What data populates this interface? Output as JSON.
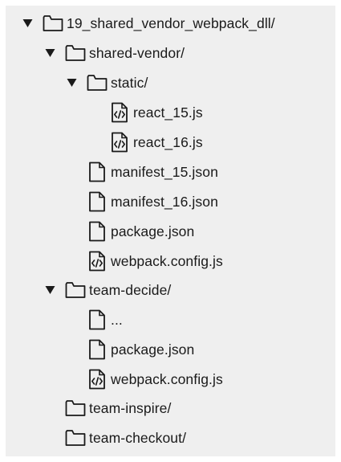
{
  "tree": {
    "root": {
      "label": "19_shared_vendor_webpack_dll/",
      "icon": "folder-icon",
      "expanded": true
    },
    "shared_vendor": {
      "label": "shared-vendor/",
      "icon": "folder-icon",
      "expanded": true
    },
    "static": {
      "label": "static/",
      "icon": "folder-icon",
      "expanded": true
    },
    "react_15": {
      "label": "react_15.js",
      "icon": "code-file-icon"
    },
    "react_16": {
      "label": "react_16.js",
      "icon": "code-file-icon"
    },
    "manifest_15": {
      "label": "manifest_15.json",
      "icon": "file-icon"
    },
    "manifest_16": {
      "label": "manifest_16.json",
      "icon": "file-icon"
    },
    "sv_package": {
      "label": "package.json",
      "icon": "file-icon"
    },
    "sv_webpack": {
      "label": "webpack.config.js",
      "icon": "code-file-icon"
    },
    "team_decide": {
      "label": "team-decide/",
      "icon": "folder-icon",
      "expanded": true
    },
    "td_ellipsis": {
      "label": "...",
      "icon": "file-icon"
    },
    "td_package": {
      "label": "package.json",
      "icon": "file-icon"
    },
    "td_webpack": {
      "label": "webpack.config.js",
      "icon": "code-file-icon"
    },
    "team_inspire": {
      "label": "team-inspire/",
      "icon": "folder-icon",
      "expanded": false
    },
    "team_checkout": {
      "label": "team-checkout/",
      "icon": "folder-icon",
      "expanded": false
    }
  },
  "colors": {
    "panel_background": "#efefef",
    "icon_stroke": "#1a1a1a",
    "text": "#1a1a1a"
  }
}
